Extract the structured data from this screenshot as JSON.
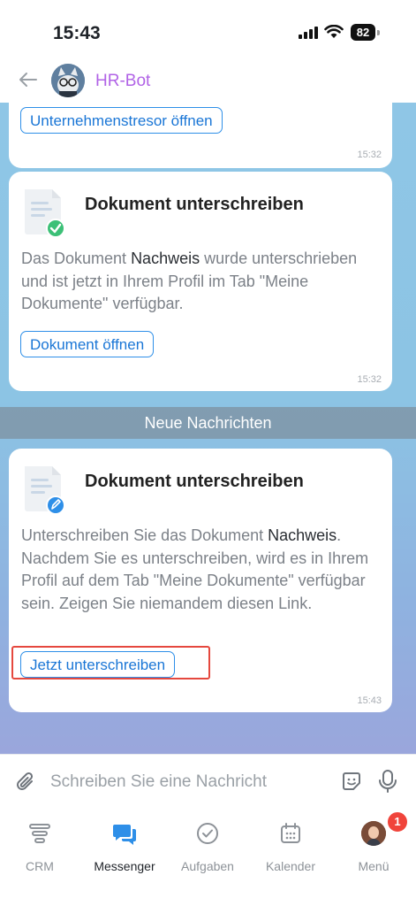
{
  "status_bar": {
    "time": "15:43",
    "battery": "82"
  },
  "header": {
    "title": "HR-Bot"
  },
  "messages": [
    {
      "button_label": "Unternehmenstresor öffnen",
      "time": "15:32"
    },
    {
      "title": "Dokument unterschreiben",
      "body_prefix": "Das Dokument ",
      "body_bold": "Nachweis",
      "body_suffix": " wurde unterschrieben und ist jetzt in Ihrem Profil im Tab \"Meine Dokumente\" verfügbar.",
      "button_label": "Dokument öffnen",
      "time": "15:32",
      "icon": "document-signed-check-icon"
    },
    {
      "title": "Dokument unterschreiben",
      "body_prefix": "Unterschreiben Sie das Dokument ",
      "body_bold": "Nachweis",
      "body_suffix": ". Nachdem Sie es unterschreiben, wird es in Ihrem Profil auf dem Tab \"Meine Dokumente\" verfügbar sein. Zeigen Sie niemandem diesen Link.",
      "button_label": "Jetzt unterschreiben",
      "time": "15:43",
      "icon": "document-sign-pen-icon"
    }
  ],
  "divider_label": "Neue Nachrichten",
  "composer": {
    "placeholder": "Schreiben Sie eine Nachricht"
  },
  "tabs": [
    {
      "label": "CRM",
      "icon": "crm-funnel-icon"
    },
    {
      "label": "Messenger",
      "icon": "messenger-icon",
      "active": true
    },
    {
      "label": "Aufgaben",
      "icon": "tasks-check-icon"
    },
    {
      "label": "Kalender",
      "icon": "calendar-icon"
    },
    {
      "label": "Menü",
      "icon": "profile-avatar",
      "badge": "1"
    }
  ],
  "colors": {
    "accent": "#2e8fe8",
    "bot_name": "#b163e6",
    "highlight": "#e5483e",
    "badge": "#f0443b"
  }
}
